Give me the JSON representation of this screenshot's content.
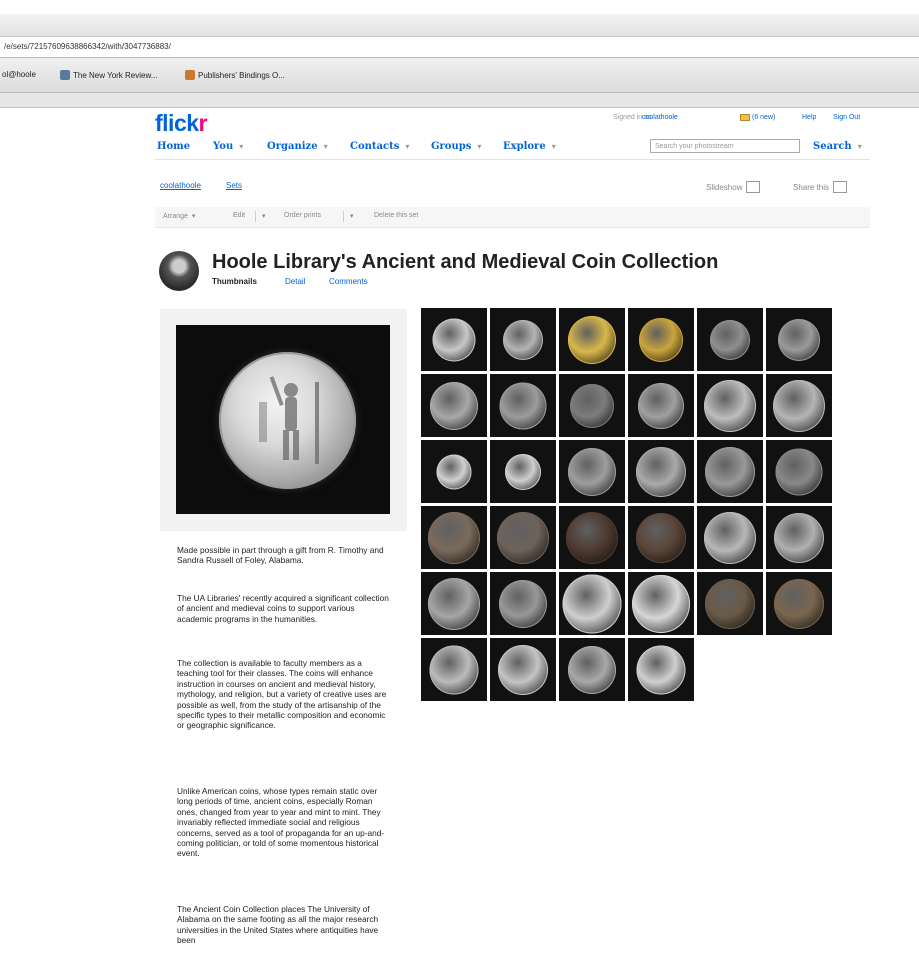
{
  "browser": {
    "url": "/e/sets/72157609638866342/with/3047736883/",
    "bookmarks": [
      {
        "label": "ol@hoole",
        "color": "#7a8fb0"
      },
      {
        "label": "The New York Review...",
        "color": "#5a7a9a"
      },
      {
        "label": "Publishers' Bindings O...",
        "color": "#c87a2a"
      }
    ]
  },
  "header": {
    "logo_flick": "flick",
    "logo_r": "r",
    "signed_in_label": "Signed in as",
    "username": "coolathoole",
    "mail_label": "(6 new)",
    "help": "Help",
    "sign_out": "Sign Out",
    "nav": [
      "Home",
      "You",
      "Organize",
      "Contacts",
      "Groups",
      "Explore"
    ],
    "search_placeholder": "Search your photostream",
    "search_button": "Search"
  },
  "breadcrumb": {
    "user": "coolathoole",
    "sets": "Sets"
  },
  "utility": {
    "slideshow": "Slideshow",
    "share": "Share this"
  },
  "toolbar": {
    "arrange": "Arrange",
    "edit": "Edit",
    "order": "Order prints",
    "delete": "Delete this set"
  },
  "set": {
    "title": "Hoole Library's Ancient and Medieval Coin Collection",
    "views": [
      "Thumbnails",
      "Detail",
      "Comments"
    ],
    "description": [
      "Made possible in part through a gift from R. Timothy and Sandra Russell of Foley, Alabama.",
      "The UA Libraries' recently acquired a significant collection of ancient and medieval coins to support various academic programs in the humanities.",
      "The collection is available to faculty members as a teaching tool for their classes. The coins will enhance instruction in courses on ancient and medieval history, mythology, and religion, but a variety of creative uses are possible as well, from the study of the artisanship of the specific types to their metallic composition and economic or geographic significance.",
      "Unlike American coins, whose types remain static over long periods of time, ancient coins, especially Roman ones, changed from year to year and mint to mint. They invariably reflected immediate social and religious concerns, served as a tool of propaganda for an up-and-coming politician, or told of some momentous historical event.",
      "The Ancient Coin Collection places The University of Alabama on the same footing as all the major research universities in the United States where antiquities have been"
    ]
  },
  "thumbnails": [
    {
      "name": "silver-coin-standing-figure",
      "color": "#c8c8c8",
      "size": 0.72
    },
    {
      "name": "silver-coin-head",
      "color": "#b4b4b4",
      "size": 0.66
    },
    {
      "name": "gold-coin-figure",
      "color": "#d9b84a",
      "size": 0.8
    },
    {
      "name": "gold-coin-standing",
      "color": "#caa53c",
      "size": 0.74
    },
    {
      "name": "dark-silver-coin",
      "color": "#8f8f8f",
      "size": 0.66
    },
    {
      "name": "dark-silver-coin-2",
      "color": "#9a9a9a",
      "size": 0.7
    },
    {
      "name": "silver-coin-portrait",
      "color": "#a8a8a8",
      "size": 0.8
    },
    {
      "name": "silver-coin-portrait-2",
      "color": "#9c9c9c",
      "size": 0.78
    },
    {
      "name": "dark-coin-figure",
      "color": "#7c7c7c",
      "size": 0.74
    },
    {
      "name": "silver-coin-worn",
      "color": "#a0a0a0",
      "size": 0.76
    },
    {
      "name": "silver-coin-star",
      "color": "#bdbdbd",
      "size": 0.86
    },
    {
      "name": "silver-coin-star-2",
      "color": "#b5b5b5",
      "size": 0.86
    },
    {
      "name": "small-silver-coin",
      "color": "#d0d0d0",
      "size": 0.58
    },
    {
      "name": "small-silver-coin-2",
      "color": "#cfcfcf",
      "size": 0.6
    },
    {
      "name": "silver-coin-cross",
      "color": "#9e9e9e",
      "size": 0.8
    },
    {
      "name": "silver-coin-grid",
      "color": "#aaaaaa",
      "size": 0.84
    },
    {
      "name": "silver-coin-dotted",
      "color": "#999999",
      "size": 0.84
    },
    {
      "name": "dark-silver-coin-3",
      "color": "#888888",
      "size": 0.78
    },
    {
      "name": "bronze-coin",
      "color": "#7a6a5c",
      "size": 0.86
    },
    {
      "name": "bronze-coin-2",
      "color": "#6e625a",
      "size": 0.86
    },
    {
      "name": "dark-bronze-coin",
      "color": "#4e3a30",
      "size": 0.86
    },
    {
      "name": "dark-bronze-coin-2",
      "color": "#5a4538",
      "size": 0.84
    },
    {
      "name": "silver-coin-bright",
      "color": "#b8b8b8",
      "size": 0.86
    },
    {
      "name": "silver-coin-bright-2",
      "color": "#b0b0b0",
      "size": 0.84
    },
    {
      "name": "silver-coin-animal",
      "color": "#a6a6a6",
      "size": 0.86
    },
    {
      "name": "silver-coin-animal-2",
      "color": "#989898",
      "size": 0.8
    },
    {
      "name": "large-silver-coin-inscription",
      "color": "#cfcfcf",
      "size": 0.98
    },
    {
      "name": "large-silver-coin-inscription-2",
      "color": "#d6d6d6",
      "size": 0.96
    },
    {
      "name": "dark-coin-ring",
      "color": "#6a5a48",
      "size": 0.84
    },
    {
      "name": "dark-coin-ring-2",
      "color": "#7a6650",
      "size": 0.84
    },
    {
      "name": "silver-coin-figure",
      "color": "#bcbcbc",
      "size": 0.82
    },
    {
      "name": "silver-coin-portrait-3",
      "color": "#c4c4c4",
      "size": 0.84
    },
    {
      "name": "silver-coin-figure-2",
      "color": "#a9a9a9",
      "size": 0.8
    },
    {
      "name": "silver-coin-standing-2",
      "color": "#d0d0d0",
      "size": 0.82
    }
  ]
}
